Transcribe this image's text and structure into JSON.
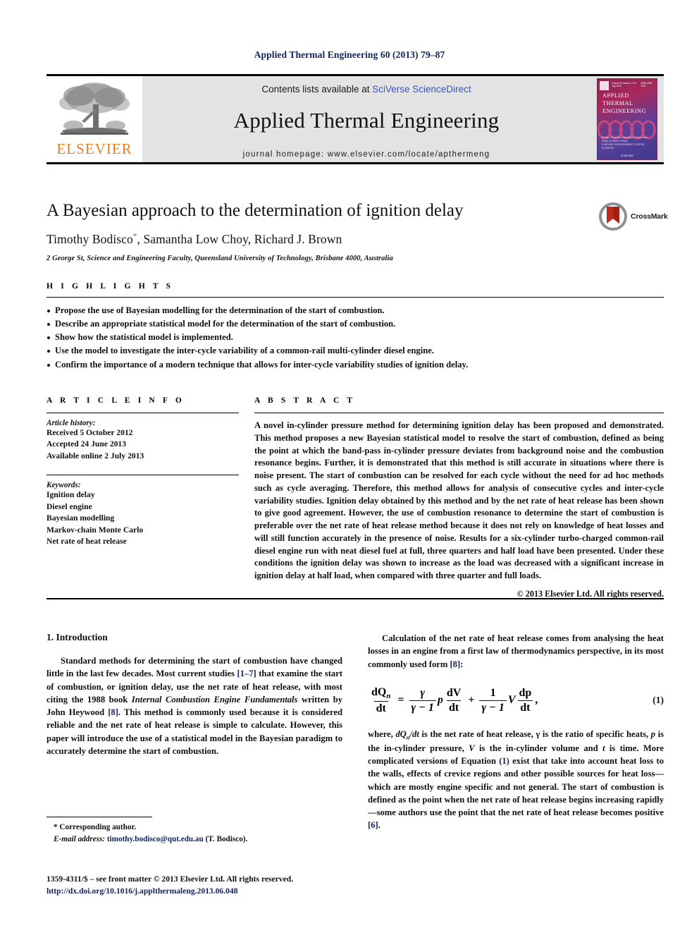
{
  "running_head": "Applied Thermal Engineering 60 (2013) 79–87",
  "masthead": {
    "publisher_name": "ELSEVIER",
    "contents_prefix": "Contents lists available at ",
    "contents_link": "SciVerse ScienceDirect",
    "journal_title": "Applied Thermal Engineering",
    "homepage": "journal homepage: www.elsevier.com/locate/apthermeng",
    "cover": {
      "volume_line": "Volume 60  Issues 1-2  10 July 2013",
      "issn_line": "ISSN 1359-4311",
      "title_line1": "APPLIED",
      "title_line2": "THERMAL",
      "title_line3": "ENGINEERING",
      "subtitle": "Design, Processes, Equipment, Economics",
      "editors": "Editor-in-Chief: D. Reay",
      "indexed_line": "ELSEVIER   SCIENCEDIRECT   SCOPUS   SCIVERSE",
      "publisher": "ELSEVIER"
    }
  },
  "article": {
    "title": "A Bayesian approach to the determination of ignition delay",
    "authors_pre": "Timothy Bodisco",
    "authors_star": "*",
    "authors_post": ", Samantha Low Choy, Richard J. Brown",
    "affiliation": "2 George St, Science and Engineering Faculty, Queensland University of Technology, Brisbane 4000, Australia",
    "crossmark_label": "CrossMark"
  },
  "highlights": {
    "heading": "H I G H L I G H T S",
    "items": [
      "Propose the use of Bayesian modelling for the determination of the start of combustion.",
      "Describe an appropriate statistical model for the determination of the start of combustion.",
      "Show how the statistical model is implemented.",
      "Use the model to investigate the inter-cycle variability of a common-rail multi-cylinder diesel engine.",
      "Confirm the importance of a modern technique that allows for inter-cycle variability studies of ignition delay."
    ]
  },
  "article_info": {
    "heading": "A R T I C L E   I N F O",
    "history_label": "Article history:",
    "history": [
      "Received 5 October 2012",
      "Accepted 24 June 2013",
      "Available online 2 July 2013"
    ],
    "keywords_label": "Keywords:",
    "keywords": [
      "Ignition delay",
      "Diesel engine",
      "Bayesian modelling",
      "Markov-chain Monte Carlo",
      "Net rate of heat release"
    ]
  },
  "abstract": {
    "heading": "A B S T R A C T",
    "text": "A novel in-cylinder pressure method for determining ignition delay has been proposed and demonstrated. This method proposes a new Bayesian statistical model to resolve the start of combustion, defined as being the point at which the band-pass in-cylinder pressure deviates from background noise and the combustion resonance begins. Further, it is demonstrated that this method is still accurate in situations where there is noise present. The start of combustion can be resolved for each cycle without the need for ad hoc methods such as cycle averaging. Therefore, this method allows for analysis of consecutive cycles and inter-cycle variability studies. Ignition delay obtained by this method and by the net rate of heat release has been shown to give good agreement. However, the use of combustion resonance to determine the start of combustion is preferable over the net rate of heat release method because it does not rely on knowledge of heat losses and will still function accurately in the presence of noise. Results for a six-cylinder turbo-charged common-rail diesel engine run with neat diesel fuel at full, three quarters and half load have been presented. Under these conditions the ignition delay was shown to increase as the load was decreased with a significant increase in ignition delay at half load, when compared with three quarter and full loads.",
    "copyright": "© 2013 Elsevier Ltd. All rights reserved."
  },
  "body": {
    "section_heading": "1. Introduction",
    "left_paragraph_parts": {
      "p1a": "Standard methods for determining the start of combustion have changed little in the last few decades. Most current studies ",
      "p1_ref1": "[1–7]",
      "p1b": " that examine the start of combustion, or ignition delay, use the net rate of heat release, with most citing the 1988 book ",
      "p1_italic": "Internal Combustion Engine Fundamentals",
      "p1c": " written by John Heywood ",
      "p1_ref2": "[8]",
      "p1d": ". This method is commonly used because it is considered reliable and the net rate of heat release is simple to calculate. However, this paper will introduce the use of a statistical model in the Bayesian paradigm to accurately determine the start of combustion."
    },
    "right_paragraph_parts": {
      "p2a": "Calculation of the net rate of heat release comes from analysing the heat losses in an engine from a first law of thermodynamics perspective, in its most commonly used form ",
      "p2_ref": "[8]",
      "p2b": ":",
      "p3a": "where, ",
      "p3_italic1": "dQ",
      "p3_sub1": "n",
      "p3_italic2": "/dt",
      "p3b": " is the net rate of heat release, ",
      "p3_gamma": "γ",
      "p3c": " is the ratio of specific heats, ",
      "p3_p": "p",
      "p3d": " is the in-cylinder pressure, ",
      "p3_V": "V",
      "p3e": " is the in-cylinder volume and ",
      "p3_t": "t",
      "p3f": " is time. More complicated versions of Equation ",
      "p3_ref1": "(1)",
      "p3g": " exist that take into account heat loss to the walls, effects of crevice regions and other possible sources for heat loss—which are mostly engine specific and not general. The start of combustion is defined as the point when the net rate of heat release begins increasing rapidly—some authors use the point that the net rate of heat release becomes positive ",
      "p3_ref2": "[6]",
      "p3h": "."
    },
    "equation": {
      "lhs_num": "dQ",
      "lhs_num_sub": "n",
      "lhs_den": "dt",
      "equals": "=",
      "t1_num": "γ",
      "t1_den": "γ − 1",
      "t1_var": "p",
      "t2_num": "dV",
      "t2_den": "dt",
      "plus": "+",
      "t3_num": "1",
      "t3_den": "γ − 1",
      "t3_var": "V",
      "t4_num": "dp",
      "t4_den": "dt",
      "comma": ",",
      "number": "(1)"
    }
  },
  "footnotes": {
    "corresponding": "* Corresponding author.",
    "email_label": "E-mail address:",
    "email": "timothy.bodisco@qut.edu.au",
    "email_suffix": "(T. Bodisco)."
  },
  "imprint": {
    "line1": "1359-4311/$ – see front matter © 2013 Elsevier Ltd. All rights reserved.",
    "doi": "http://dx.doi.org/10.1016/j.applthermaleng.2013.06.048"
  },
  "colors": {
    "link_blue": "#3a55b4",
    "ref_navy": "#12235e",
    "elsevier_orange": "#f07c1e",
    "masthead_grey": "#e3e3e3"
  }
}
